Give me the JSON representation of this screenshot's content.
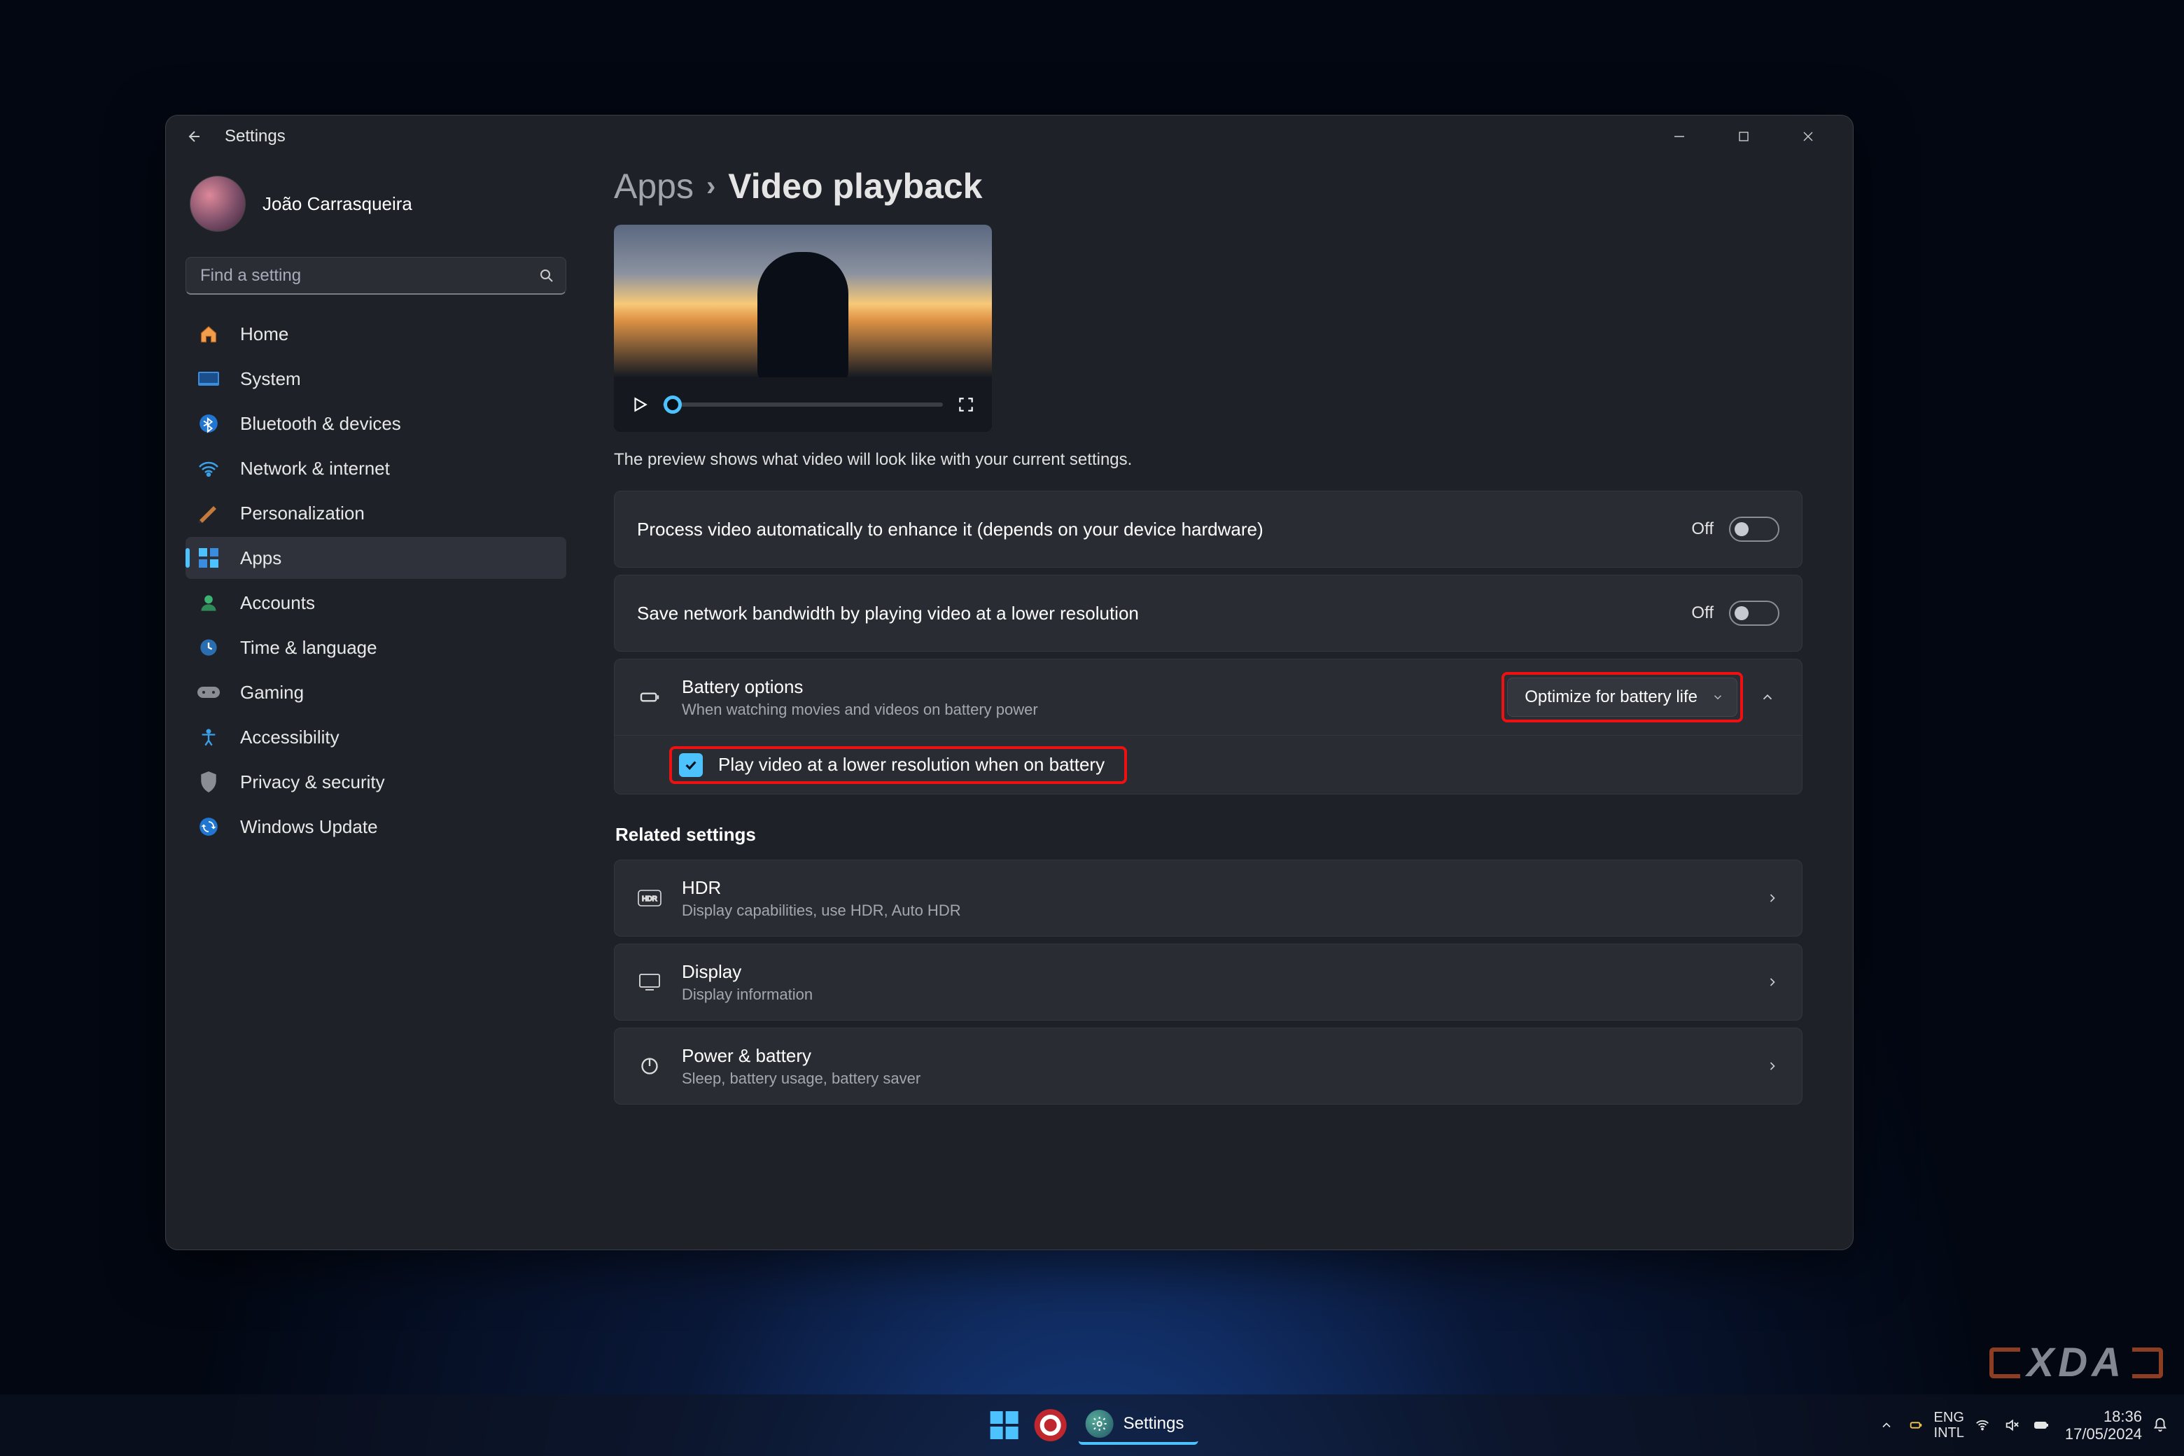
{
  "window": {
    "title": "Settings",
    "user": "João Carrasqueira",
    "search_placeholder": "Find a setting"
  },
  "nav": [
    {
      "icon": "home",
      "label": "Home"
    },
    {
      "icon": "system",
      "label": "System"
    },
    {
      "icon": "bluetooth",
      "label": "Bluetooth & devices"
    },
    {
      "icon": "network",
      "label": "Network & internet"
    },
    {
      "icon": "personalization",
      "label": "Personalization"
    },
    {
      "icon": "apps",
      "label": "Apps",
      "active": true
    },
    {
      "icon": "accounts",
      "label": "Accounts"
    },
    {
      "icon": "time",
      "label": "Time & language"
    },
    {
      "icon": "gaming",
      "label": "Gaming"
    },
    {
      "icon": "accessibility",
      "label": "Accessibility"
    },
    {
      "icon": "privacy",
      "label": "Privacy & security"
    },
    {
      "icon": "update",
      "label": "Windows Update"
    }
  ],
  "breadcrumb": {
    "parent": "Apps",
    "current": "Video playback"
  },
  "preview_caption": "The preview shows what video will look like with your current settings.",
  "settings": {
    "process": {
      "label": "Process video automatically to enhance it (depends on your device hardware)",
      "state": "Off"
    },
    "bandwidth": {
      "label": "Save network bandwidth by playing video at a lower resolution",
      "state": "Off"
    },
    "battery": {
      "title": "Battery options",
      "sub": "When watching movies and videos on battery power",
      "dropdown": "Optimize for battery life",
      "check_label": "Play video at a lower resolution when on battery"
    }
  },
  "related_heading": "Related settings",
  "related": [
    {
      "title": "HDR",
      "sub": "Display capabilities, use HDR, Auto HDR",
      "icon": "hdr"
    },
    {
      "title": "Display",
      "sub": "Display information",
      "icon": "display"
    },
    {
      "title": "Power & battery",
      "sub": "Sleep, battery usage, battery saver",
      "icon": "power"
    }
  ],
  "taskbar": {
    "app": "Settings"
  },
  "tray": {
    "lang1": "ENG",
    "lang2": "INTL",
    "time": "18:36",
    "date": "17/05/2024"
  },
  "watermark": "XDA"
}
